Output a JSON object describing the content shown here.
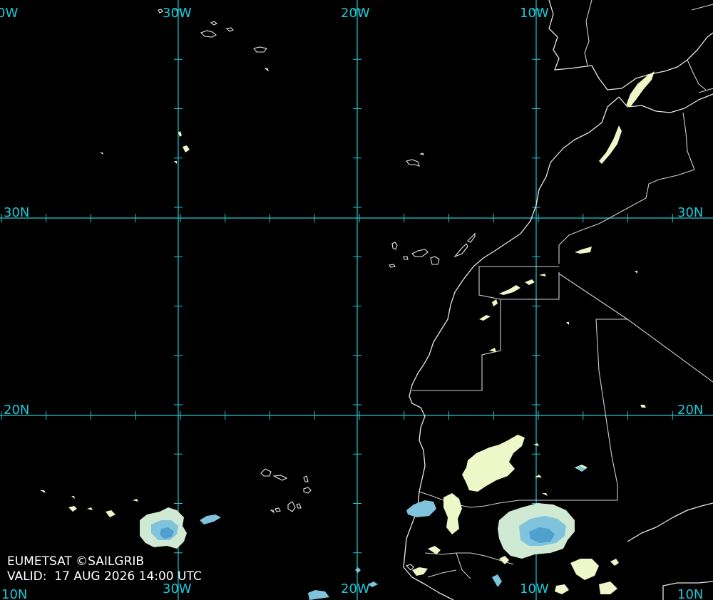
{
  "map": {
    "longitude_labels": [
      "30W",
      "20W",
      "10W"
    ],
    "latitude_labels": [
      "30N",
      "20N",
      "10N"
    ],
    "edge_labels": {
      "top_left": "0W",
      "bottom_left": "10N"
    },
    "colors": {
      "background": "#000000",
      "grid": "#1fc9d6",
      "coastline": "#e8e8e8",
      "cloud_light": "#eef7c8",
      "cloud_blue": "#7fc3dd",
      "cloud_deep": "#4f9fcf"
    }
  },
  "credit": {
    "source": "EUMETSAT ©SAILGRIB",
    "valid": "VALID:  17 AUG 2026 14:00 UTC"
  }
}
